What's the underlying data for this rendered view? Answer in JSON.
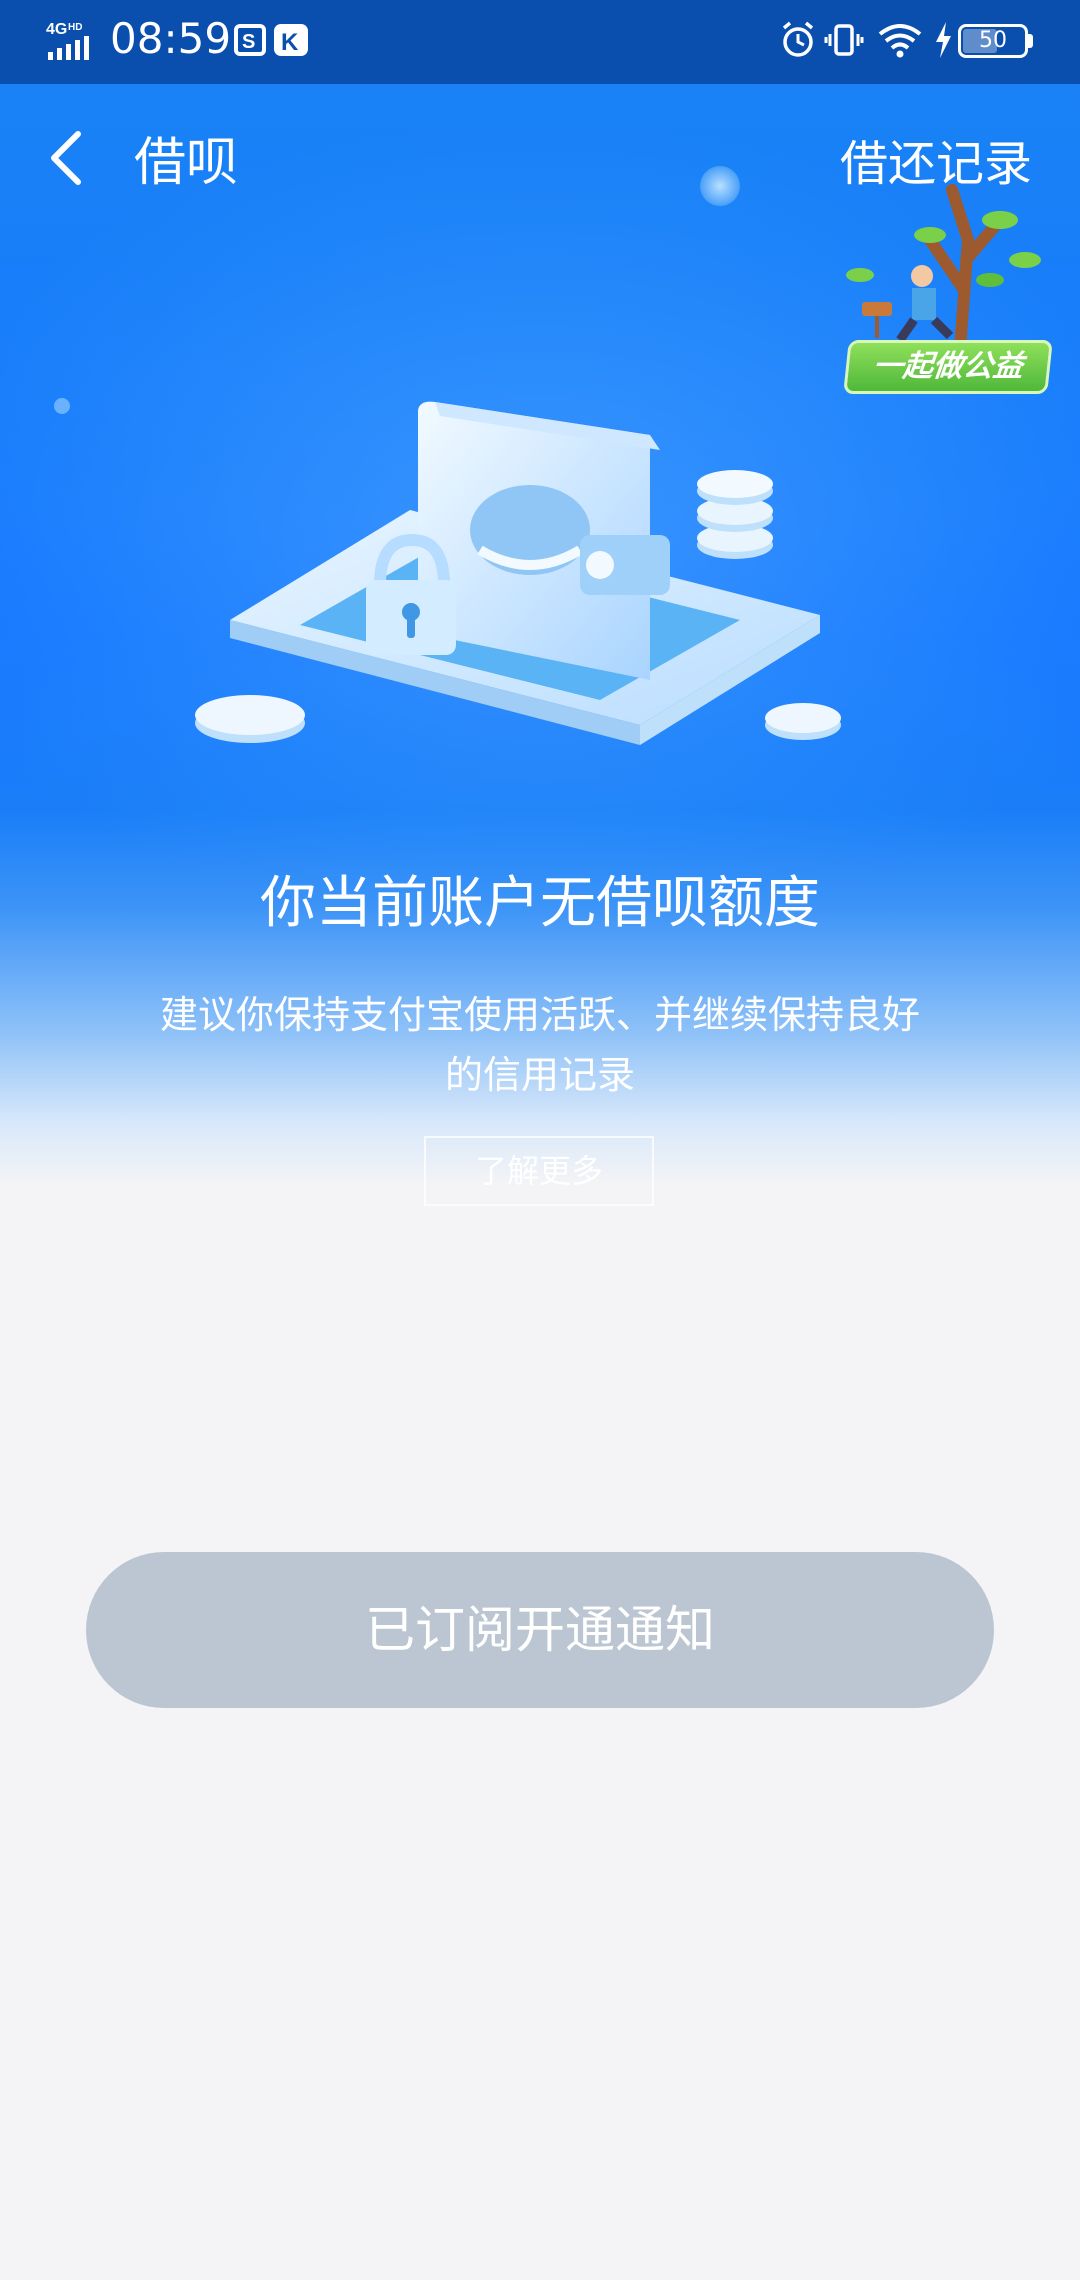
{
  "status_bar": {
    "network": "4G HD",
    "time": "08:59",
    "battery": "50"
  },
  "nav": {
    "title": "借呗",
    "right_link": "借还记录"
  },
  "banner": {
    "text": "一起做公益"
  },
  "main": {
    "headline": "你当前账户无借呗额度",
    "description": "建议你保持支付宝使用活跃、并继续保持良好的信用记录",
    "learn_more": "了解更多"
  },
  "footer": {
    "subscribe_button": "已订阅开通通知"
  },
  "colors": {
    "primary_blue": "#1677ff",
    "status_bar": "#0a4fae",
    "disabled_button": "#bbc6d2",
    "page_bg": "#f4f4f6"
  }
}
